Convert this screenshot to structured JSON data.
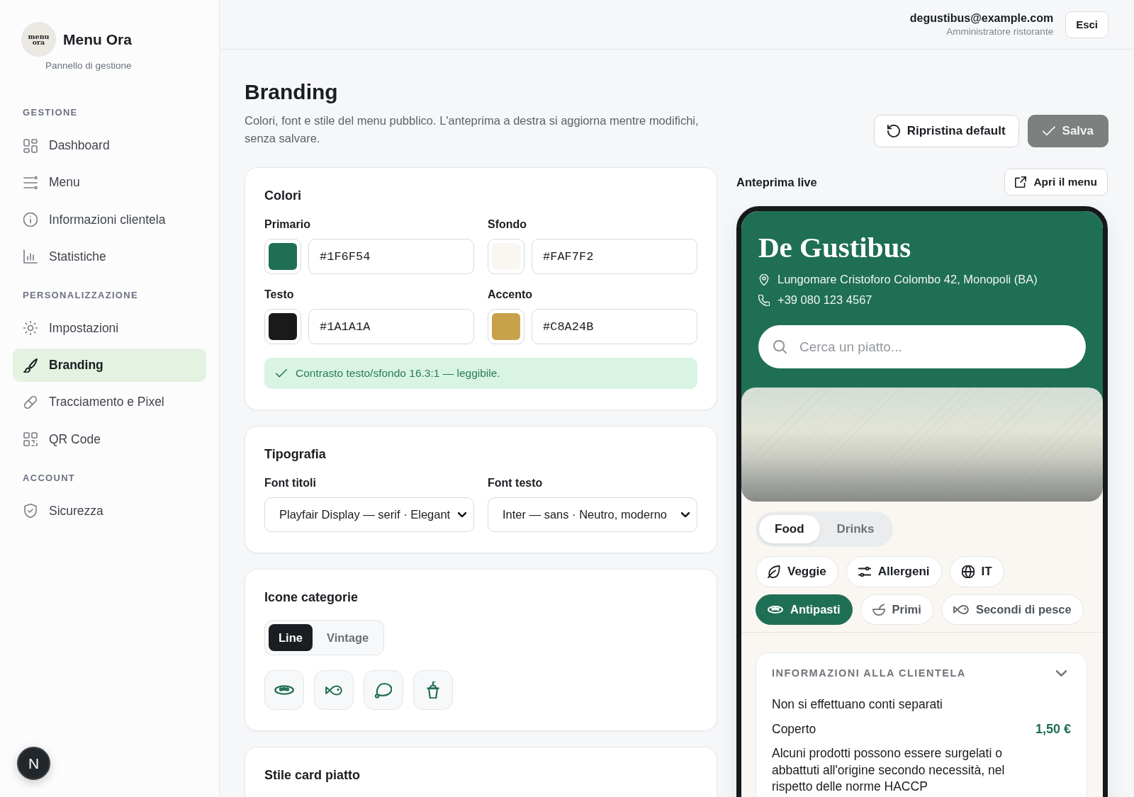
{
  "sidebar": {
    "logo_lines": [
      "menu",
      "ora"
    ],
    "title": "Menu Ora",
    "subtitle": "Pannello di gestione",
    "sections": [
      {
        "heading": "GESTIONE",
        "items": [
          {
            "label": "Dashboard",
            "selected": false
          },
          {
            "label": "Menu",
            "selected": false
          },
          {
            "label": "Informazioni clientela",
            "selected": false
          },
          {
            "label": "Statistiche",
            "selected": false
          }
        ]
      },
      {
        "heading": "PERSONALIZZAZIONE",
        "items": [
          {
            "label": "Impostazioni",
            "selected": false
          },
          {
            "label": "Branding",
            "selected": true
          },
          {
            "label": "Tracciamento e Pixel",
            "selected": false
          },
          {
            "label": "QR Code",
            "selected": false
          }
        ]
      },
      {
        "heading": "ACCOUNT",
        "items": [
          {
            "label": "Sicurezza",
            "selected": false
          }
        ]
      }
    ],
    "dev_badge": "N"
  },
  "header": {
    "email": "degustibus@example.com",
    "role": "Amministratore ristorante",
    "logout": "Esci"
  },
  "page": {
    "title": "Branding",
    "description": "Colori, font e stile del menu pubblico. L'anteprima a destra si aggiorna mentre modifichi, senza salvare.",
    "actions": [
      {
        "label": "Ripristina default",
        "kind": "reset",
        "disabled": false
      },
      {
        "label": "Salva",
        "kind": "save",
        "disabled": true
      }
    ]
  },
  "colors_card": {
    "title": "Colori",
    "fields": [
      {
        "label": "Primario",
        "value": "#1F6F54",
        "color": "#1f6f54"
      },
      {
        "label": "Sfondo",
        "value": "#FAF7F2",
        "color": "#faf7f2"
      },
      {
        "label": "Testo",
        "value": "#1A1A1A",
        "color": "#1a1a1a"
      },
      {
        "label": "Accento",
        "value": "#C8A24B",
        "color": "#c8a24b"
      }
    ],
    "contrast_note": "Contrasto testo/sfondo 16.3:1 — leggibile."
  },
  "typography_card": {
    "title": "Tipografia",
    "fields": [
      {
        "label": "Font titoli",
        "value": "Playfair Display — serif · Elegant"
      },
      {
        "label": "Font testo",
        "value": "Inter — sans · Neutro, moderno"
      }
    ]
  },
  "icons_card": {
    "title": "Icone categorie",
    "styles": [
      {
        "label": "Line",
        "selected": true
      },
      {
        "label": "Vintage",
        "selected": false
      }
    ]
  },
  "dish_card_style": {
    "title": "Stile card piatto"
  },
  "preview": {
    "title": "Anteprima live",
    "open_button": "Apri il menu",
    "restaurant": {
      "name": "De Gustibus",
      "address": "Lungomare Cristoforo Colombo 42, Monopoli (BA)",
      "phone": "+39 080 123 4567"
    },
    "search": {
      "placeholder": "Cerca un piatto..."
    },
    "menu_tabs": [
      {
        "label": "Food",
        "selected": true
      },
      {
        "label": "Drinks",
        "selected": false
      }
    ],
    "filters": [
      "Veggie",
      "Allergeni",
      "IT"
    ],
    "categories": [
      {
        "label": "Antipasti",
        "selected": true
      },
      {
        "label": "Primi",
        "selected": false
      },
      {
        "label": "Secondi di pesce",
        "selected": false
      }
    ],
    "info_card": {
      "title": "INFORMAZIONI ALLA CLIENTELA",
      "expanded": true,
      "lines": [
        {
          "kind": "text",
          "text": "Non si effettuano conti separati"
        },
        {
          "kind": "price",
          "text": "Coperto",
          "value": "1,50 €"
        },
        {
          "kind": "text",
          "text": "Alcuni prodotti possono essere surgelati o abbattuti all'origine secondo necessità, nel rispetto delle norme HACCP"
        }
      ]
    }
  }
}
